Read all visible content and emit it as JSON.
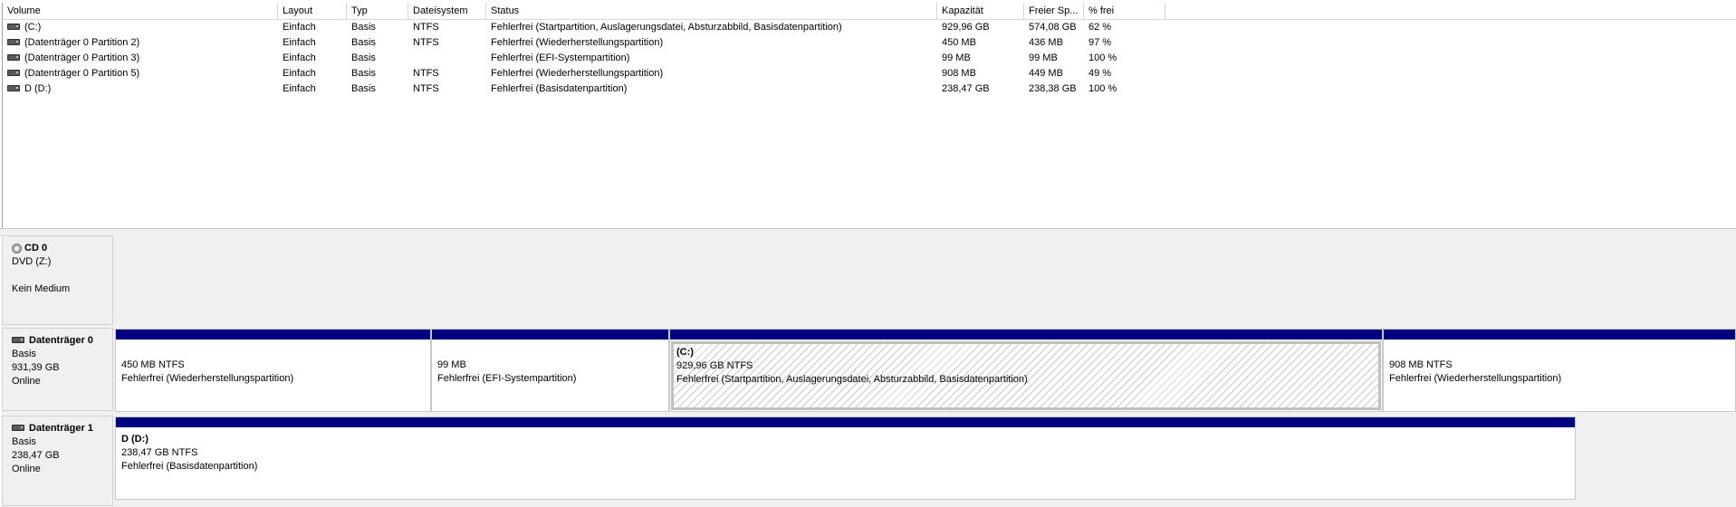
{
  "columns": [
    "Volume",
    "Layout",
    "Typ",
    "Dateisystem",
    "Status",
    "Kapazität",
    "Freier Sp...",
    "% frei"
  ],
  "volumes": [
    {
      "volume": "(C:)",
      "layout": "Einfach",
      "typ": "Basis",
      "dateisystem": "NTFS",
      "status": "Fehlerfrei (Startpartition, Auslagerungsdatei, Absturzabbild, Basisdatenpartition)",
      "kapazitaet": "929,96 GB",
      "frei": "574,08 GB",
      "prozent": "62 %"
    },
    {
      "volume": "(Datenträger 0 Partition 2)",
      "layout": "Einfach",
      "typ": "Basis",
      "dateisystem": "NTFS",
      "status": "Fehlerfrei (Wiederherstellungspartition)",
      "kapazitaet": "450 MB",
      "frei": "436 MB",
      "prozent": "97 %"
    },
    {
      "volume": "(Datenträger 0 Partition 3)",
      "layout": "Einfach",
      "typ": "Basis",
      "dateisystem": "",
      "status": "Fehlerfrei (EFI-Systempartition)",
      "kapazitaet": "99 MB",
      "frei": "99 MB",
      "prozent": "100 %"
    },
    {
      "volume": "(Datenträger 0 Partition 5)",
      "layout": "Einfach",
      "typ": "Basis",
      "dateisystem": "NTFS",
      "status": "Fehlerfrei (Wiederherstellungspartition)",
      "kapazitaet": "908 MB",
      "frei": "449 MB",
      "prozent": "49 %"
    },
    {
      "volume": "D (D:)",
      "layout": "Einfach",
      "typ": "Basis",
      "dateisystem": "NTFS",
      "status": "Fehlerfrei (Basisdatenpartition)",
      "kapazitaet": "238,47 GB",
      "frei": "238,38 GB",
      "prozent": "100 %"
    }
  ],
  "cd0": {
    "name": "CD 0",
    "drive": "DVD (Z:)",
    "state": "Kein Medium"
  },
  "disk0": {
    "name": "Datenträger 0",
    "type": "Basis",
    "size": "931,39 GB",
    "state": "Online",
    "partitions": [
      {
        "name": "",
        "size": "450 MB NTFS",
        "status": "Fehlerfrei (Wiederherstellungspartition)"
      },
      {
        "name": "",
        "size": "99 MB",
        "status": "Fehlerfrei (EFI-Systempartition)"
      },
      {
        "name": "(C:)",
        "size": "929,96 GB NTFS",
        "status": "Fehlerfrei (Startpartition, Auslagerungsdatei, Absturzabbild, Basisdatenpartition)"
      },
      {
        "name": "",
        "size": "908 MB NTFS",
        "status": "Fehlerfrei (Wiederherstellungspartition)"
      }
    ]
  },
  "disk1": {
    "name": "Datenträger 1",
    "type": "Basis",
    "size": "238,47 GB",
    "state": "Online",
    "partitions": [
      {
        "name": "D  (D:)",
        "size": "238,47 GB NTFS",
        "status": "Fehlerfrei (Basisdatenpartition)"
      }
    ]
  },
  "colors": {
    "partition_bar": "#000080",
    "background": "#f0f0f0"
  }
}
